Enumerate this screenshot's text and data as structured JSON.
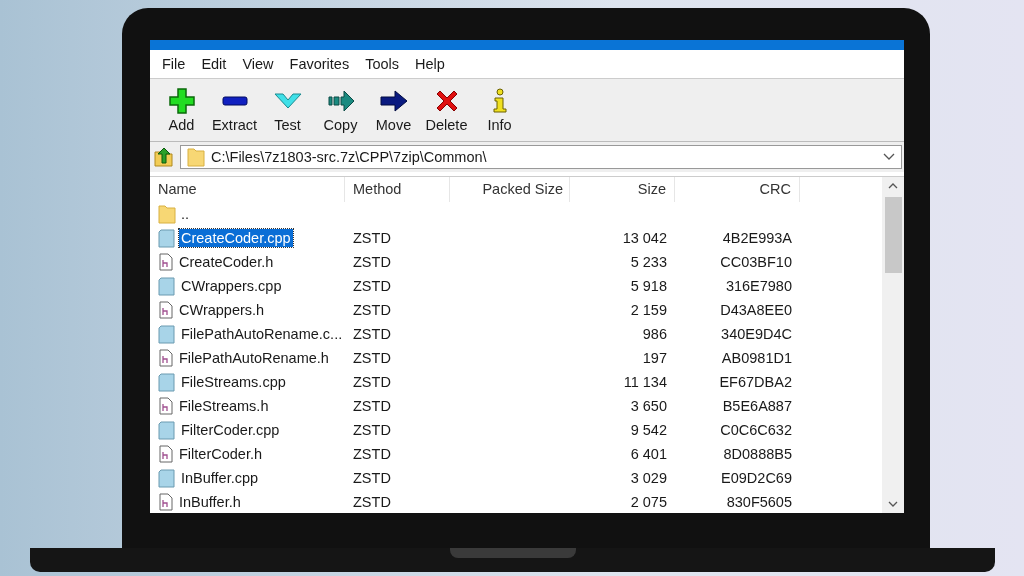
{
  "menu": [
    "File",
    "Edit",
    "View",
    "Favorites",
    "Tools",
    "Help"
  ],
  "toolbar": [
    {
      "kind": "add",
      "label": "Add"
    },
    {
      "kind": "extract",
      "label": "Extract"
    },
    {
      "kind": "test",
      "label": "Test"
    },
    {
      "kind": "copy",
      "label": "Copy"
    },
    {
      "kind": "move",
      "label": "Move"
    },
    {
      "kind": "delete",
      "label": "Delete"
    },
    {
      "kind": "info",
      "label": "Info"
    }
  ],
  "address": {
    "value": "C:\\Files\\7z1803-src.7z\\CPP\\7zip\\Common\\"
  },
  "table": {
    "columns": [
      "Name",
      "Method",
      "Packed Size",
      "Size",
      "CRC"
    ],
    "rows": [
      {
        "kind": "folder",
        "name": "..",
        "method": "",
        "size": "",
        "crc": "",
        "selected": false
      },
      {
        "kind": "cpp",
        "name": "CreateCoder.cpp",
        "method": "ZSTD",
        "size": "13 042",
        "crc": "4B2E993A",
        "selected": true
      },
      {
        "kind": "h",
        "name": "CreateCoder.h",
        "method": "ZSTD",
        "size": "5 233",
        "crc": "CC03BF10",
        "selected": false
      },
      {
        "kind": "cpp",
        "name": "CWrappers.cpp",
        "method": "ZSTD",
        "size": "5 918",
        "crc": "316E7980",
        "selected": false
      },
      {
        "kind": "h",
        "name": "CWrappers.h",
        "method": "ZSTD",
        "size": "2 159",
        "crc": "D43A8EE0",
        "selected": false
      },
      {
        "kind": "cpp",
        "name": "FilePathAutoRename.c...",
        "method": "ZSTD",
        "size": "986",
        "crc": "340E9D4C",
        "selected": false
      },
      {
        "kind": "h",
        "name": "FilePathAutoRename.h",
        "method": "ZSTD",
        "size": "197",
        "crc": "AB0981D1",
        "selected": false
      },
      {
        "kind": "cpp",
        "name": "FileStreams.cpp",
        "method": "ZSTD",
        "size": "11 134",
        "crc": "EF67DBA2",
        "selected": false
      },
      {
        "kind": "h",
        "name": "FileStreams.h",
        "method": "ZSTD",
        "size": "3 650",
        "crc": "B5E6A887",
        "selected": false
      },
      {
        "kind": "cpp",
        "name": "FilterCoder.cpp",
        "method": "ZSTD",
        "size": "9 542",
        "crc": "C0C6C632",
        "selected": false
      },
      {
        "kind": "h",
        "name": "FilterCoder.h",
        "method": "ZSTD",
        "size": "6 401",
        "crc": "8D0888B5",
        "selected": false
      },
      {
        "kind": "cpp",
        "name": "InBuffer.cpp",
        "method": "ZSTD",
        "size": "3 029",
        "crc": "E09D2C69",
        "selected": false
      },
      {
        "kind": "h",
        "name": "InBuffer.h",
        "method": "ZSTD",
        "size": "2 075",
        "crc": "830F5605",
        "selected": false
      }
    ]
  }
}
